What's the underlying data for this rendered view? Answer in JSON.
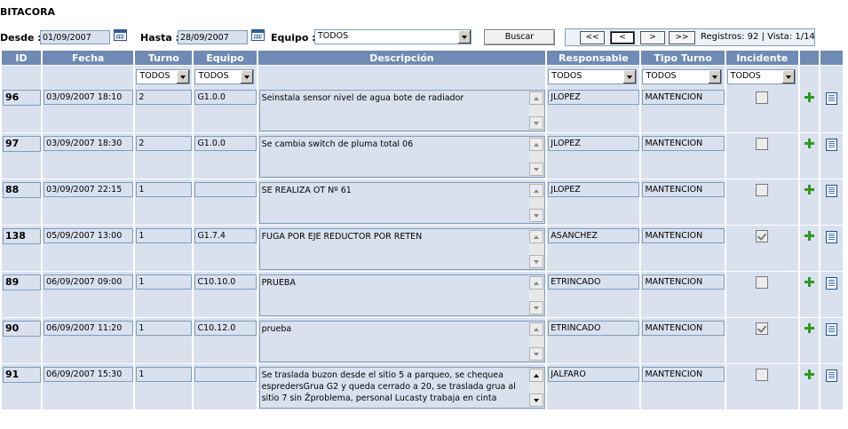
{
  "page": {
    "title": "BITACORA"
  },
  "filters": {
    "desde_label": "Desde :",
    "desde_value": "01/09/2007",
    "hasta_label": "Hasta :",
    "hasta_value": "28/09/2007",
    "equipo_label": "Equipo :",
    "equipo_value": "TODOS",
    "buscar_label": "Buscar"
  },
  "pager": {
    "first": "<<",
    "prev": "<",
    "next": ">",
    "last": ">>",
    "info": "Registros: 92 | Vista: 1/14"
  },
  "columns": {
    "id": "ID",
    "fecha": "Fecha",
    "turno": "Turno",
    "equipo": "Equipo",
    "descripcion": "Descripción",
    "responsable": "Responsable",
    "tipo_turno": "Tipo Turno",
    "incidente": "Incidente"
  },
  "column_filters": {
    "turno": "TODOS",
    "equipo": "TODOS",
    "responsable": "TODOS",
    "tipo_turno": "TODOS",
    "incidente": "TODOS"
  },
  "rows": [
    {
      "id": "96",
      "fecha": "03/09/2007 18:10",
      "turno": "2",
      "equipo": "G1.0.0",
      "descripcion": "Seinstala sensor nivel de agua bote de radiador",
      "responsable": "JLOPEZ",
      "tipo_turno": "MANTENCION",
      "incidente": false
    },
    {
      "id": "97",
      "fecha": "03/09/2007 18:30",
      "turno": "2",
      "equipo": "G1.0.0",
      "descripcion": "Se cambia switch de pluma total 06",
      "responsable": "JLOPEZ",
      "tipo_turno": "MANTENCION",
      "incidente": false
    },
    {
      "id": "88",
      "fecha": "03/09/2007 22:15",
      "turno": "1",
      "equipo": "",
      "descripcion": "SE REALIZA OT Nº 61",
      "responsable": "JLOPEZ",
      "tipo_turno": "MANTENCION",
      "incidente": false
    },
    {
      "id": "138",
      "fecha": "05/09/2007 13:00",
      "turno": "1",
      "equipo": "G1.7.4",
      "descripcion": "FUGA POR EJE REDUCTOR POR RETEN",
      "responsable": "ASANCHEZ",
      "tipo_turno": "MANTENCION",
      "incidente": true
    },
    {
      "id": "89",
      "fecha": "06/09/2007 09:00",
      "turno": "1",
      "equipo": "C10.10.0",
      "descripcion": "PRUEBA",
      "responsable": "ETRINCADO",
      "tipo_turno": "MANTENCION",
      "incidente": false
    },
    {
      "id": "90",
      "fecha": "06/09/2007 11:20",
      "turno": "1",
      "equipo": "C10.12.0",
      "descripcion": "prueba",
      "responsable": "ETRINCADO",
      "tipo_turno": "MANTENCION",
      "incidente": true
    },
    {
      "id": "91",
      "fecha": "06/09/2007 15:30",
      "turno": "1",
      "equipo": "",
      "descripcion": "Se traslada buzon desde el sitio 5 a parqueo, se chequea espredersGrua G2  y queda  cerrado a 20, se traslada grua al sitio 7 sin Žproblema, personal Lucasty trabaja en cinta",
      "responsable": "JALFARO",
      "tipo_turno": "MANTENCION",
      "incidente": false
    }
  ]
}
